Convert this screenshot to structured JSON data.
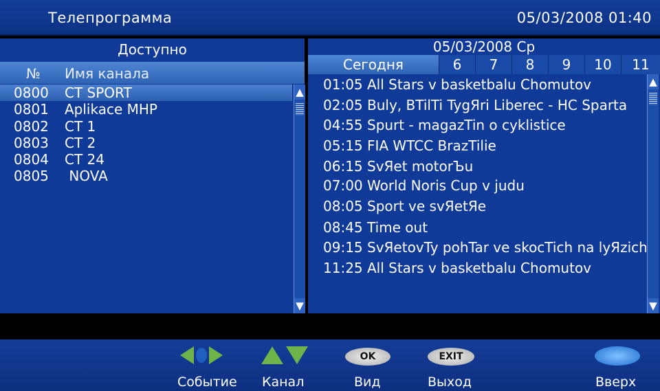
{
  "header": {
    "title": "Телепрограмма",
    "datetime": "05/03/2008 01:40"
  },
  "channels_panel": {
    "title": "Доступно",
    "col_number": "№",
    "col_name": "Имя канала",
    "items": [
      {
        "number": "0800",
        "name": "CT SPORT",
        "selected": true
      },
      {
        "number": "0801",
        "name": "Aplikace MHP"
      },
      {
        "number": "0802",
        "name": "CT 1"
      },
      {
        "number": "0803",
        "name": "CT 2"
      },
      {
        "number": "0804",
        "name": "CT 24"
      },
      {
        "number": "0805",
        "name": " NOVA"
      }
    ]
  },
  "epg_panel": {
    "date": "05/03/2008  Ср",
    "tabs": [
      "Сегодня",
      "6",
      "7",
      "8",
      "9",
      "10",
      "11"
    ],
    "programs": [
      "01:05 All Stars v basketbalu Chomutov",
      "02:05 Buly, BTilTi TygЯri Liberec - HC Sparta",
      "04:55 Spurt - magazTin o cyklistice",
      "05:15 FIA WTCC BrazTilie",
      "06:15 SvЯet motorЪu",
      "07:00 World Noris Cup v judu",
      "08:05 Sport ve svЯetЯe",
      "08:45 Time out",
      "09:15 SvЯetovTy pohTar ve skocTich na lyЯzich",
      "11:25 All Stars v basketbalu Chomutov"
    ]
  },
  "footer": {
    "event_label": "Событие",
    "channel_label": "Канал",
    "view_label": "Вид",
    "view_key": "OK",
    "exit_label": "Выход",
    "exit_key": "EXIT",
    "up_label": "Вверх"
  },
  "icons": {
    "scroll_up": "▲",
    "scroll_down": "▼"
  },
  "colors": {
    "panel_blue": "#103a98",
    "highlight_blue": "#4a80d0",
    "arrow_green": "#6fb34a",
    "button_silver": "#d8d8d8",
    "button_blue": "#3a8ee0"
  }
}
